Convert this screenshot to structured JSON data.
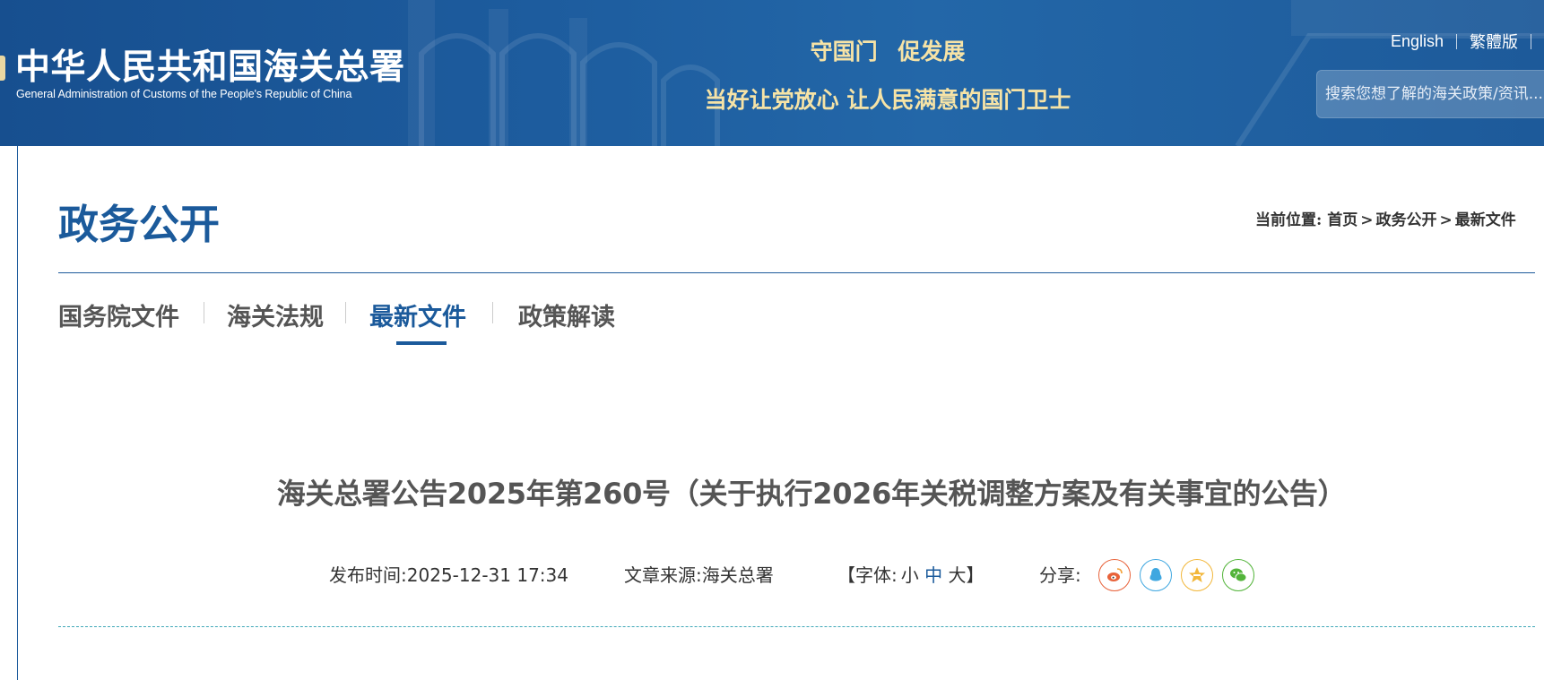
{
  "header": {
    "logo_cn": "中华人民共和国海关总署",
    "logo_en": "General Administration of Customs of the People's Republic of China",
    "slogan_line1": "守国门 促发展",
    "slogan_line2": "当好让党放心 让人民满意的国门卫士",
    "lang_english": "English",
    "lang_traditional": "繁體版",
    "search_placeholder": "搜索您想了解的海关政策/资讯..."
  },
  "page": {
    "title": "政务公开",
    "breadcrumb": {
      "prefix": "当前位置:",
      "items": [
        "首页",
        "政务公开",
        "最新文件"
      ],
      "separator": ">"
    }
  },
  "tabs": [
    {
      "label": "国务院文件",
      "active": false
    },
    {
      "label": "海关法规",
      "active": false
    },
    {
      "label": "最新文件",
      "active": true
    },
    {
      "label": "政策解读",
      "active": false
    }
  ],
  "article": {
    "title": "海关总署公告2025年第260号（关于执行2026年关税调整方案及有关事宜的公告）",
    "publish_label": "发布时间:",
    "publish_time": "2025-12-31 17:34",
    "source_label": "文章来源:",
    "source": "海关总署",
    "fontsize_open": "【字体:",
    "fontsize_small": "小",
    "fontsize_medium": "中",
    "fontsize_large": "大",
    "fontsize_close": "】",
    "share_label": "分享:",
    "share_icons": [
      "weibo-icon",
      "qq-icon",
      "qzone-icon",
      "wechat-icon"
    ]
  },
  "colors": {
    "brand_blue": "#1b5a9b",
    "header_bg": "#1d5c9e",
    "slogan_gold": "#f6e3a6",
    "weibo": "#e8623a",
    "qq": "#3fa7e0",
    "qzone": "#f2b73a",
    "wechat": "#53b43a"
  }
}
